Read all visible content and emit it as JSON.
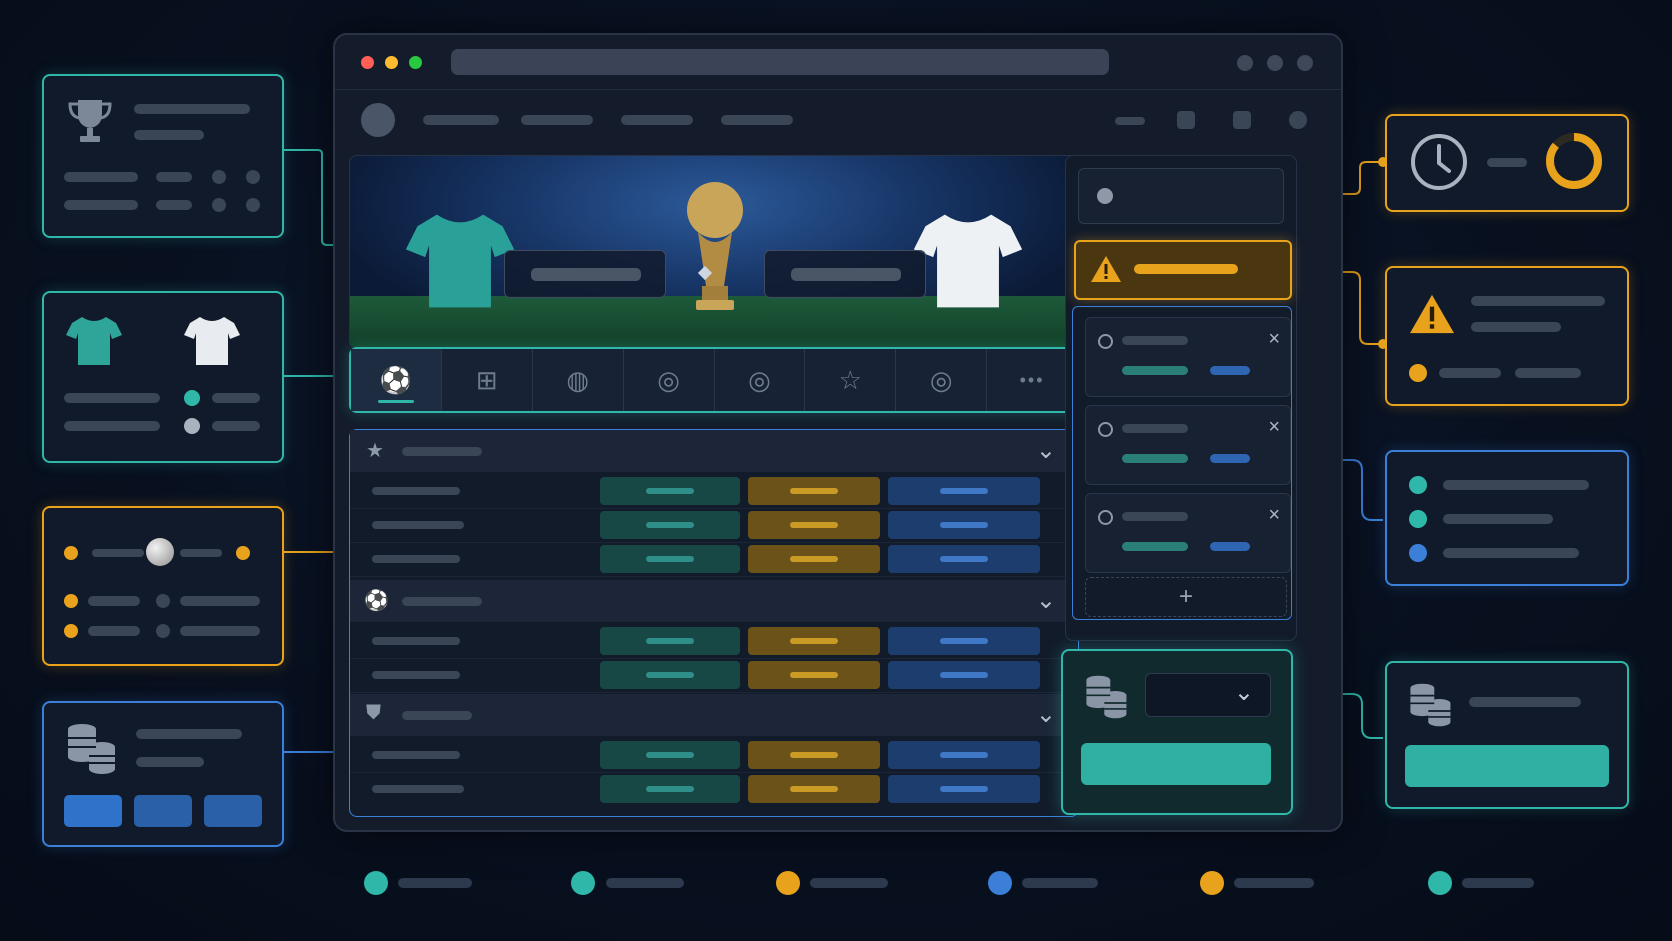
{
  "window": {
    "controls": [
      "close",
      "minimize",
      "maximize"
    ],
    "controls_colors": [
      "#ff5f57",
      "#febc2e",
      "#28c840"
    ]
  },
  "sports_tabs": [
    {
      "icon": "soccer-ball-icon",
      "glyph": "⚽",
      "active": true
    },
    {
      "icon": "pitch-icon",
      "glyph": "⊞",
      "active": false
    },
    {
      "icon": "basketball-icon",
      "glyph": "◍",
      "active": false
    },
    {
      "icon": "tennis-ball-icon",
      "glyph": "◎",
      "active": false
    },
    {
      "icon": "volleyball-icon",
      "glyph": "◎",
      "active": false
    },
    {
      "icon": "star-icon",
      "glyph": "☆",
      "active": false
    },
    {
      "icon": "ball-icon",
      "glyph": "◎",
      "active": false
    },
    {
      "icon": "more-icon",
      "glyph": "•••",
      "active": false
    }
  ],
  "match_groups": [
    {
      "icon": "star-icon",
      "glyph": "★",
      "rows": 3
    },
    {
      "icon": "soccer-ball-icon",
      "glyph": "⚽",
      "rows": 2
    },
    {
      "icon": "shield-icon",
      "glyph": "⛊",
      "rows": 2
    }
  ],
  "bet_slip": {
    "add_glyph": "+",
    "remove_glyph": "×",
    "items": 3
  },
  "colors": {
    "teal": "#2fb8aa",
    "gold": "#e8a21c",
    "blue": "#3b7fd9",
    "background": "#08101f"
  },
  "icons": {
    "trophy": "trophy-icon",
    "clock": "clock-icon",
    "warning": "warning-icon",
    "coins": "coins-icon",
    "chevron": "chevron-down-icon",
    "jersey_home": "jersey-teal-icon",
    "jersey_away": "jersey-white-icon"
  },
  "warning_glyph": "!",
  "dropdown_glyph": "⌄"
}
